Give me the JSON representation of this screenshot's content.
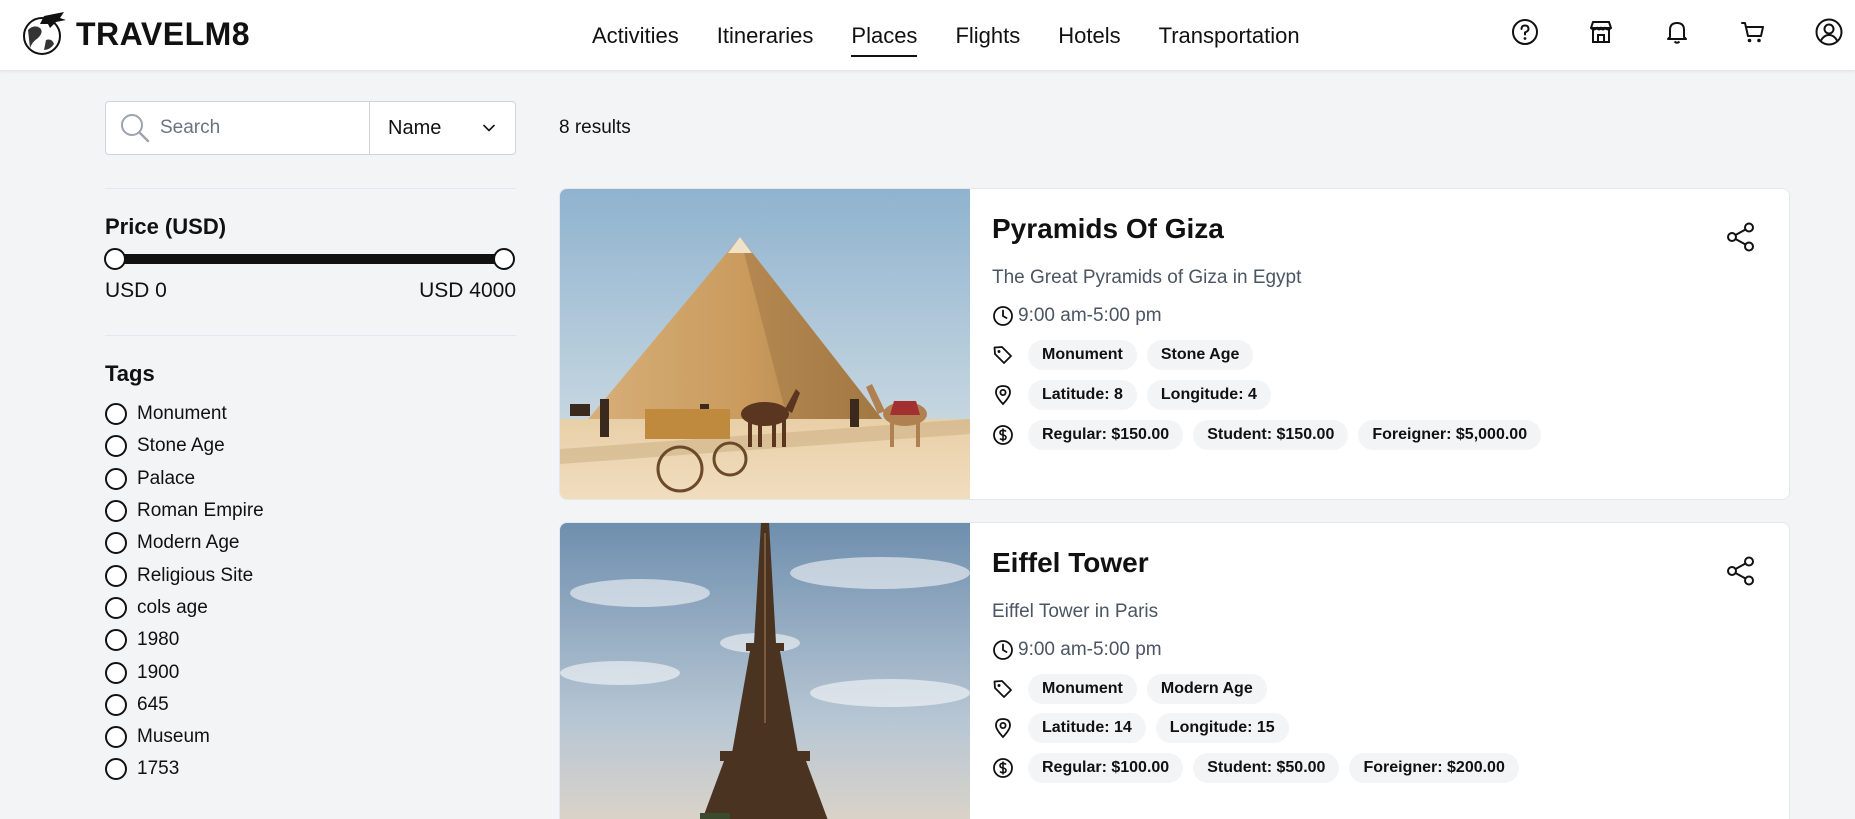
{
  "header": {
    "logo_text": "TRAVELM8",
    "nav": [
      {
        "label": "Activities",
        "active": false
      },
      {
        "label": "Itineraries",
        "active": false
      },
      {
        "label": "Places",
        "active": true
      },
      {
        "label": "Flights",
        "active": false
      },
      {
        "label": "Hotels",
        "active": false
      },
      {
        "label": "Transportation",
        "active": false
      }
    ],
    "icons": [
      "help-icon",
      "store-icon",
      "bell-icon",
      "cart-icon",
      "user-icon"
    ]
  },
  "sidebar": {
    "search": {
      "placeholder": "Search",
      "value": ""
    },
    "sort": {
      "selected": "Name"
    },
    "price": {
      "title": "Price (USD)",
      "min_label": "USD 0",
      "max_label": "USD 4000",
      "min": 0,
      "max": 4000
    },
    "tags": {
      "title": "Tags",
      "items": [
        "Monument",
        "Stone Age",
        "Palace",
        "Roman Empire",
        "Modern Age",
        "Religious Site",
        "cols age",
        "1980",
        "1900",
        "645",
        "Museum",
        "1753"
      ]
    }
  },
  "results": {
    "count_label": "8 results",
    "places": [
      {
        "title": "Pyramids Of Giza",
        "description": "The Great Pyramids of Giza in Egypt",
        "hours": "9:00 am-5:00 pm",
        "tags": [
          "Monument",
          "Stone Age"
        ],
        "location": [
          "Latitude: 8",
          "Longitude: 4"
        ],
        "prices": [
          "Regular: $150.00",
          "Student: $150.00",
          "Foreigner: $5,000.00"
        ]
      },
      {
        "title": "Eiffel Tower",
        "description": "Eiffel Tower in Paris",
        "hours": "9:00 am-5:00 pm",
        "tags": [
          "Monument",
          "Modern Age"
        ],
        "location": [
          "Latitude: 14",
          "Longitude: 15"
        ],
        "prices": [
          "Regular: $100.00",
          "Student: $50.00",
          "Foreigner: $200.00"
        ]
      }
    ]
  },
  "colors": {
    "accent": "#111111",
    "background": "#f3f4f6",
    "pill": "#f3f4f6",
    "muted_text": "#4b5563"
  }
}
